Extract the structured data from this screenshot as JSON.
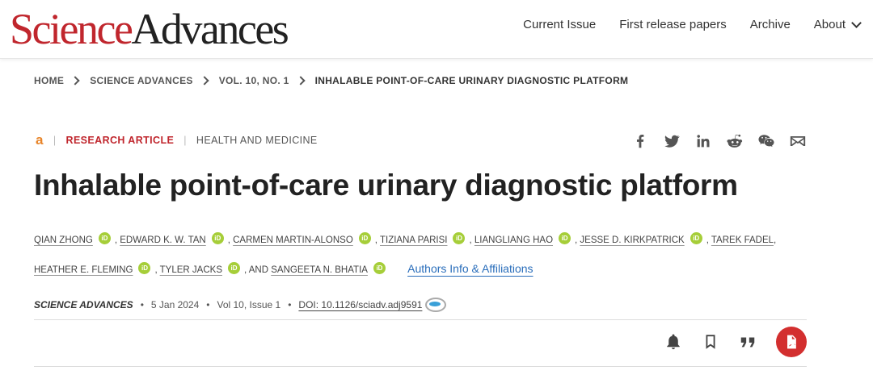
{
  "header": {
    "logo_part1": "Science",
    "logo_part2": "Advances",
    "nav": [
      "Current Issue",
      "First release papers",
      "Archive",
      "About"
    ]
  },
  "breadcrumb": [
    "HOME",
    "SCIENCE ADVANCES",
    "VOL. 10, NO. 1",
    "INHALABLE POINT-OF-CARE URINARY DIAGNOSTIC PLATFORM"
  ],
  "article": {
    "open_access_symbol": "a",
    "type": "RESEARCH ARTICLE",
    "subject": "HEALTH AND MEDICINE",
    "title": "Inhalable point-of-care urinary diagnostic platform",
    "authors": [
      "QIAN ZHONG",
      "EDWARD K. W. TAN",
      "CARMEN MARTIN-ALONSO",
      "TIZIANA PARISI",
      "LIANGLIANG HAO",
      "JESSE D. KIRKPATRICK",
      "TAREK FADEL",
      "HEATHER E. FLEMING",
      "TYLER JACKS",
      "SANGEETA N. BHATIA"
    ],
    "and_text": "AND",
    "orcid_label": "iD",
    "affiliations_link": "Authors Info & Affiliations",
    "journal": "SCIENCE ADVANCES",
    "date": "5 Jan 2024",
    "volume": "Vol 10, Issue 1",
    "doi": "DOI: 10.1126/sciadv.adj9591",
    "bullet": "•"
  },
  "share_icons": [
    "facebook-icon",
    "twitter-icon",
    "linkedin-icon",
    "reddit-icon",
    "wechat-icon",
    "email-icon"
  ],
  "action_icons": [
    "bell-icon",
    "bookmark-icon",
    "quote-icon",
    "pdf-icon"
  ],
  "colors": {
    "brand_red": "#c0262d",
    "link_blue": "#2a6ebb",
    "orcid_green": "#a6ce39",
    "pdf_red": "#d32f2f",
    "open_access_orange": "#e8852a"
  }
}
